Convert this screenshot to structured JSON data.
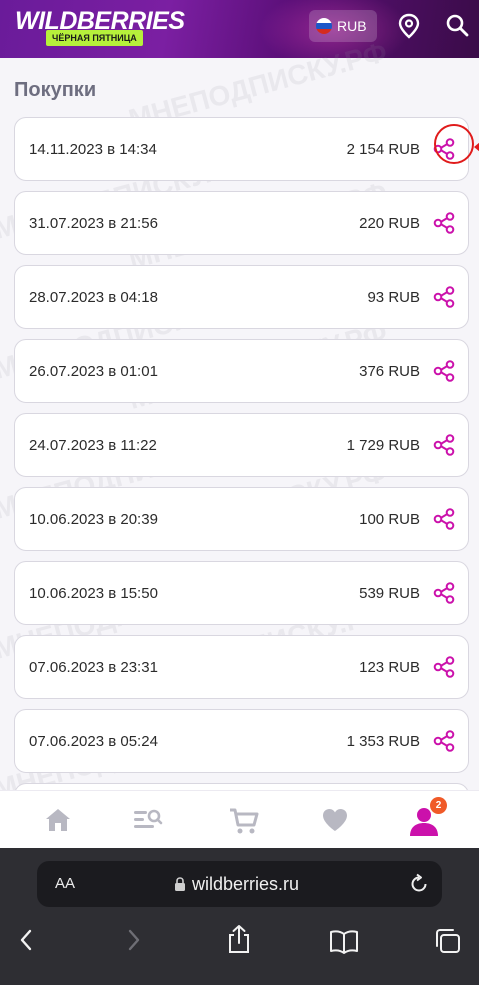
{
  "header": {
    "logo": "WILDBERRIES",
    "promo": "ЧЁРНАЯ ПЯТНИЦА",
    "currency": "RUB",
    "icons": [
      "russia-flag-icon",
      "location-pin-icon",
      "search-icon"
    ]
  },
  "page": {
    "title": "Покупки"
  },
  "purchases": [
    {
      "date": "14.11.2023 в 14:34",
      "amount": "2 154 RUB"
    },
    {
      "date": "31.07.2023 в 21:56",
      "amount": "220 RUB"
    },
    {
      "date": "28.07.2023 в 04:18",
      "amount": "93 RUB"
    },
    {
      "date": "26.07.2023 в 01:01",
      "amount": "376 RUB"
    },
    {
      "date": "24.07.2023 в 11:22",
      "amount": "1 729 RUB"
    },
    {
      "date": "10.06.2023 в 20:39",
      "amount": "100 RUB"
    },
    {
      "date": "10.06.2023 в 15:50",
      "amount": "539 RUB"
    },
    {
      "date": "07.06.2023 в 23:31",
      "amount": "123 RUB"
    },
    {
      "date": "07.06.2023 в 05:24",
      "amount": "1 353 RUB"
    }
  ],
  "bottom_nav": {
    "items": [
      "home-icon",
      "catalog-search-icon",
      "cart-icon",
      "favorites-heart-icon",
      "profile-icon"
    ],
    "profile_badge": "2"
  },
  "browser": {
    "text_size": "AA",
    "url": "wildberries.ru",
    "toolbar": [
      "back-icon",
      "forward-icon",
      "share-icon",
      "bookmarks-icon",
      "tabs-icon"
    ]
  },
  "watermark": "МНЕПОДПИСКУ.РФ",
  "colors": {
    "header": "#6a1b9a",
    "share_icon": "#cb11ab",
    "highlight": "#e01b1b",
    "badge": "#f05a28",
    "nav_icon": "#b8b8c2",
    "nav_active": "#cb11ab"
  }
}
